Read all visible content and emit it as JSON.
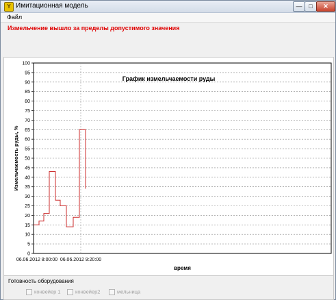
{
  "window": {
    "title": "Имитационная модель"
  },
  "menu": {
    "file": "Файл"
  },
  "warning": {
    "text": "Измельчение вышло за пределы допустимого значения"
  },
  "chart": {
    "title": "График измельчаемости руды"
  },
  "chart_data": {
    "type": "line",
    "title": "График измельчаемости руды",
    "xlabel": "время",
    "ylabel": "Измельчаемость руды, %",
    "ylim": [
      0,
      100
    ],
    "yticks": [
      "0",
      "5",
      "10",
      "15",
      "20",
      "25",
      "30",
      "35",
      "40",
      "45",
      "50",
      "55",
      "60",
      "65",
      "70",
      "75",
      "80",
      "85",
      "90",
      "95",
      "100"
    ],
    "xticks": [
      "06.06.2012 8:00:00",
      "06.06.2012 9:20:00"
    ],
    "grid": true,
    "series": [
      {
        "color": "#cc2b2b",
        "y": [
          15,
          15,
          17,
          17,
          21,
          21,
          43,
          43,
          28,
          28,
          25,
          25,
          14,
          14,
          19,
          19,
          65,
          65,
          34
        ]
      }
    ]
  },
  "status": {
    "title": "Готовность оборудования",
    "items": [
      "конвейер 1",
      "конвейер2",
      "мельница"
    ]
  },
  "colors": {
    "warning": "#e00000",
    "series": "#cc2b2b"
  }
}
